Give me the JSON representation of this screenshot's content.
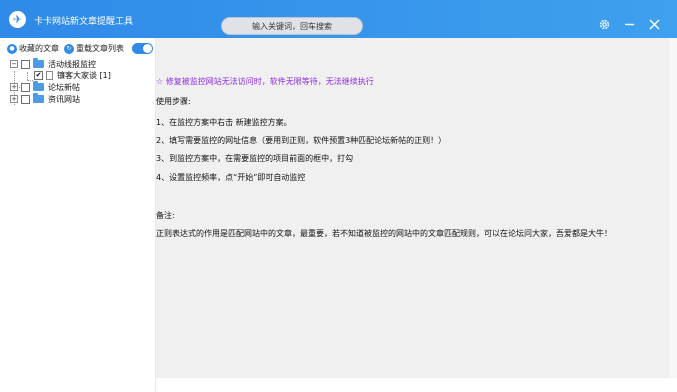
{
  "window": {
    "title": "卡卡网站新文章提醒工具"
  },
  "search": {
    "placeholder": "输入关键词，回车搜索"
  },
  "sidebar": {
    "collected_label": "收藏的文章",
    "reload_label": "重载文章列表",
    "tree": [
      {
        "label": "活动线报监控",
        "children": [
          {
            "label": "镰客大家谈 [1]",
            "checked": true
          }
        ]
      },
      {
        "label": "论坛新帖"
      },
      {
        "label": "资讯网站"
      }
    ]
  },
  "content": {
    "highlight": "☆ 修复被监控网站无法访问时，软件无限等待，无法继续执行",
    "steps_title": "使用步骤:",
    "steps": [
      "1、在监控方案中右击 新建监控方案。",
      "2、填写需要监控的网址信息（要用到正则，软件预置3种匹配论坛新帖的正则！）",
      "3、到监控方案中，在需要监控的项目前面的框中，打勾",
      "4、设置监控频率，点“开始”即可自动监控"
    ],
    "note_title": "备注:",
    "note_text": "正则表达式的作用是匹配网站中的文章，最重要，若不知道被监控的网站中的文章匹配规则，可以在论坛问大家，吾爱都是大牛！"
  },
  "colors": {
    "titlebar": "#2f8ae8",
    "highlight": "#8a2be2",
    "content_bg": "#f0f0f0"
  }
}
